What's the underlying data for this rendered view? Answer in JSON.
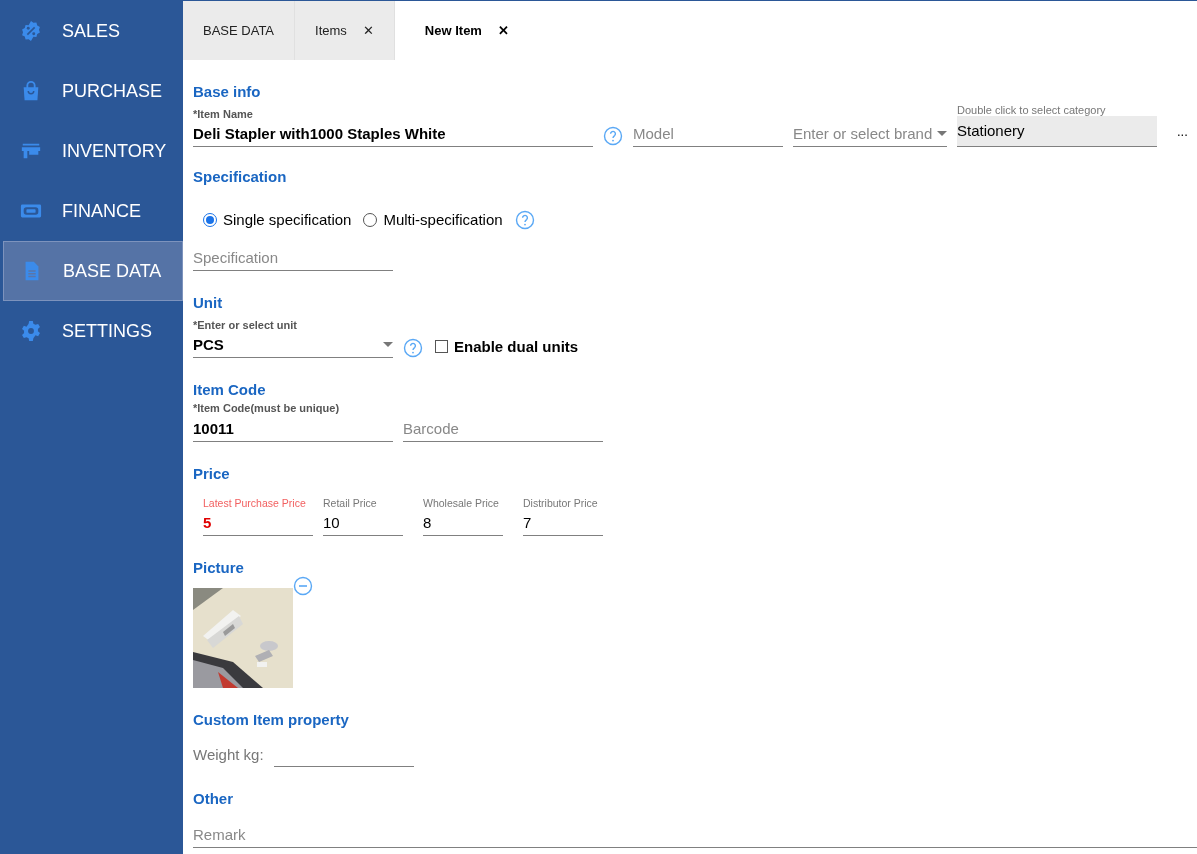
{
  "sidebar": {
    "items": [
      {
        "label": "SALES",
        "selected": false
      },
      {
        "label": "PURCHASE",
        "selected": false
      },
      {
        "label": "INVENTORY",
        "selected": false
      },
      {
        "label": "FINANCE",
        "selected": false
      },
      {
        "label": "BASE DATA",
        "selected": true
      },
      {
        "label": "SETTINGS",
        "selected": false
      }
    ]
  },
  "tabs": [
    {
      "label": "BASE DATA",
      "selected": false,
      "closable": false
    },
    {
      "label": "Items",
      "selected": false,
      "closable": true
    },
    {
      "label": "New Item",
      "selected": true,
      "closable": true
    }
  ],
  "close_glyph": "✕",
  "base_info": {
    "title": "Base info",
    "item_name": {
      "label": "*Item Name",
      "value": "Deli Stapler with1000 Staples White"
    },
    "model": {
      "placeholder": "Model"
    },
    "brand": {
      "placeholder": "Enter or select brand"
    },
    "category": {
      "label": "Double click to select category",
      "value": "Stationery"
    },
    "more_button": "..."
  },
  "specification": {
    "title": "Specification",
    "options": [
      {
        "label": "Single specification",
        "selected": true
      },
      {
        "label": "Multi-specification",
        "selected": false
      }
    ],
    "field": {
      "placeholder": "Specification"
    }
  },
  "unit": {
    "title": "Unit",
    "unit_field": {
      "label": "*Enter or select unit",
      "value": "PCS"
    },
    "dual_units": {
      "label": "Enable dual units",
      "checked": false
    }
  },
  "item_code": {
    "title": "Item Code",
    "code": {
      "label": "*Item Code(must be unique)",
      "value": "10011"
    },
    "barcode": {
      "placeholder": "Barcode"
    }
  },
  "price": {
    "title": "Price",
    "fields": [
      {
        "label": "Latest Purchase Price",
        "value": "5",
        "highlighted": true
      },
      {
        "label": "Retail Price",
        "value": "10",
        "highlighted": false
      },
      {
        "label": "Wholesale Price",
        "value": "8",
        "highlighted": false
      },
      {
        "label": "Distributor Price",
        "value": "7",
        "highlighted": false
      }
    ]
  },
  "picture": {
    "title": "Picture"
  },
  "custom_property": {
    "title": "Custom Item property",
    "fields": [
      {
        "label": "Weight kg:"
      }
    ]
  },
  "other": {
    "title": "Other",
    "remark": {
      "placeholder": "Remark"
    }
  }
}
